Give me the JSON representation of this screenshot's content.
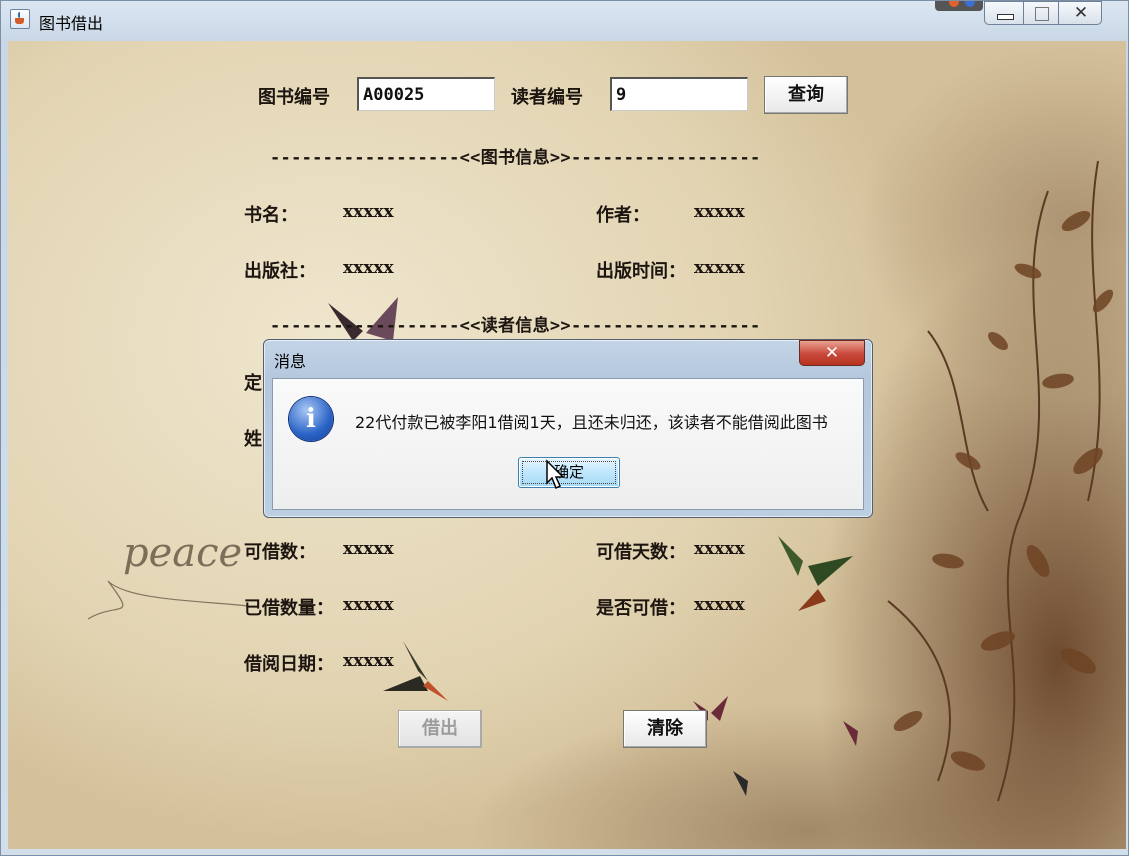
{
  "window": {
    "title": "图书借出",
    "controls": {
      "close_glyph": "✕"
    }
  },
  "query": {
    "book_id_label": "图书编号",
    "book_id_value": "A00025",
    "reader_id_label": "读者编号",
    "reader_id_value": "9",
    "query_button": "查询"
  },
  "book_section": {
    "header": "------------------<<图书信息>>------------------",
    "title_label": "书名：",
    "title_value": "xxxxx",
    "author_label": "作者：",
    "author_value": "xxxxx",
    "publisher_label": "出版社：",
    "publisher_value": "xxxxx",
    "pub_date_label": "出版时间：",
    "pub_date_value": "xxxxx"
  },
  "reader_section": {
    "header": "------------------<<读者信息>>------------------",
    "partial_label_1": "定",
    "partial_label_2": "姓",
    "borrowable_count_label": "可借数：",
    "borrowable_count_value": "xxxxx",
    "borrowable_days_label": "可借天数：",
    "borrowable_days_value": "xxxxx",
    "borrowed_count_label": "已借数量：",
    "borrowed_count_value": "xxxxx",
    "can_borrow_label": "是否可借：",
    "can_borrow_value": "xxxxx",
    "borrow_date_label": "借阅日期：",
    "borrow_date_value": "xxxxx"
  },
  "actions": {
    "borrow_button": "借出",
    "clear_button": "清除"
  },
  "dialog": {
    "title": "消息",
    "close_glyph": "✕",
    "icon": "info-icon",
    "message": "22代付款已被李阳1借阅1天，且还未归还，该读者不能借阅此图书",
    "ok_button": "确定"
  },
  "background": {
    "script_text": "peace"
  }
}
